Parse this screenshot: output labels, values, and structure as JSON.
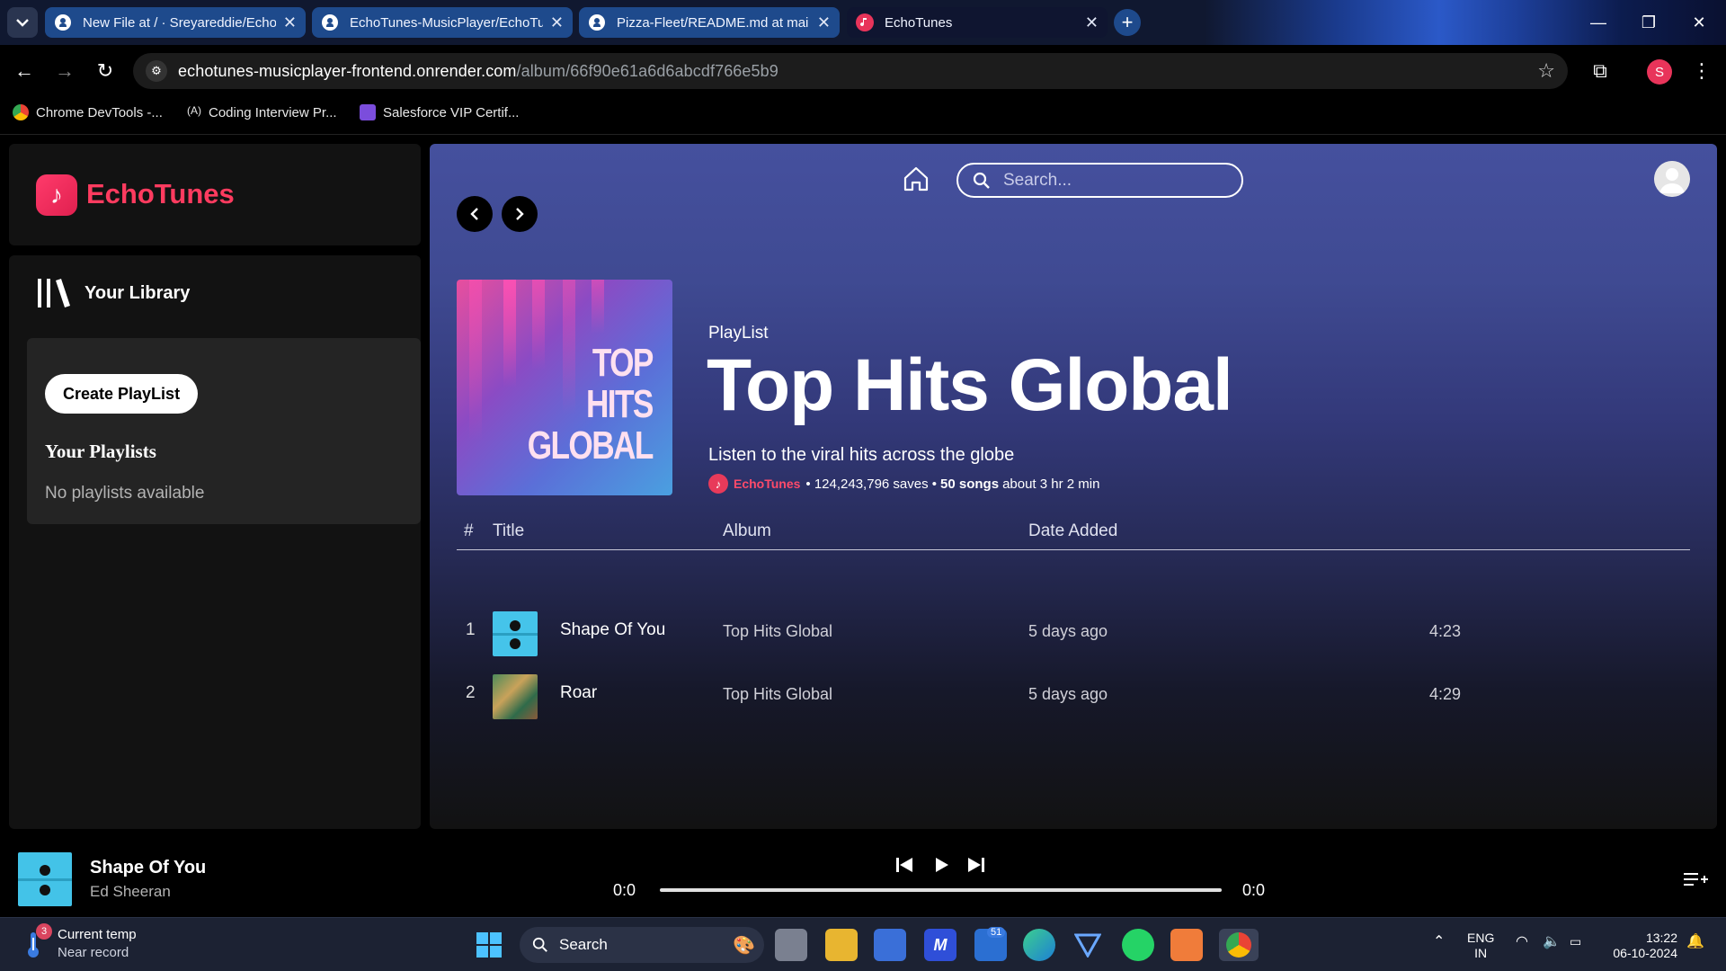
{
  "browser": {
    "tabs": [
      {
        "label": "New File at / · Sreyareddie/Echo",
        "icon": "github-icon"
      },
      {
        "label": "EchoTunes-MusicPlayer/EchoTu",
        "icon": "github-icon"
      },
      {
        "label": "Pizza-Fleet/README.md at mai",
        "icon": "github-icon"
      },
      {
        "label": "EchoTunes",
        "icon": "echotunes-icon"
      }
    ],
    "url_host": "echotunes-musicplayer-frontend.onrender.com",
    "url_path": "/album/66f90e61a6d6abcdf766e5b9",
    "profile_initial": "S",
    "bookmarks": [
      {
        "label": "Chrome DevTools -..."
      },
      {
        "label": "Coding Interview Pr..."
      },
      {
        "label": "Salesforce VIP Certif..."
      }
    ]
  },
  "sidebar": {
    "app_name": "EchoTunes",
    "library_label": "Your Library",
    "create_button": "Create PlayList",
    "playlists_heading": "Your Playlists",
    "playlists_empty": "No playlists available"
  },
  "header": {
    "search_placeholder": "Search..."
  },
  "playlist": {
    "cover_text": [
      "TOP",
      "HITS",
      "GLOBAL"
    ],
    "type": "PlayList",
    "title": "Top Hits Global",
    "description": "Listen to the viral hits across the globe",
    "owner": "EchoTunes",
    "saves": "• 124,243,796 saves •",
    "songs": "50 songs",
    "duration": "about 3 hr 2 min"
  },
  "table": {
    "headers": {
      "num": "#",
      "title": "Title",
      "album": "Album",
      "date": "Date Added"
    },
    "rows": [
      {
        "num": "1",
        "title": "Shape Of You",
        "album": "Top Hits Global",
        "date": "5 days ago",
        "duration": "4:23"
      },
      {
        "num": "2",
        "title": "Roar",
        "album": "Top Hits Global",
        "date": "5 days ago",
        "duration": "4:29"
      }
    ]
  },
  "player": {
    "title": "Shape Of You",
    "artist": "Ed Sheeran",
    "current_time": "0:0",
    "total_time": "0:0",
    "progress": 0
  },
  "taskbar": {
    "weather_title": "Current temp",
    "weather_sub": "Near record",
    "weather_badge": "3",
    "search_label": "Search",
    "mail_badge": "51",
    "lang_1": "ENG",
    "lang_2": "IN",
    "time": "13:22",
    "date": "06-10-2024"
  },
  "colors": {
    "brand": "#ff3b5f",
    "main_gradient_top": "#45509e",
    "panel": "#121212"
  }
}
